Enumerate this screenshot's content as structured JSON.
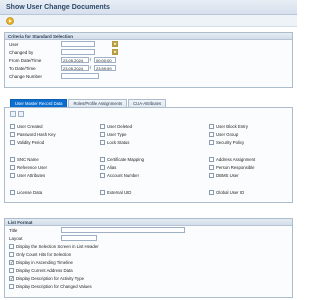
{
  "page": {
    "title": "Show User Change Documents"
  },
  "toolbar": {
    "execute_icon": "execute-icon"
  },
  "criteria": {
    "header": "Criteria for Standard Selection",
    "user_label": "User",
    "changed_by_label": "Changed by",
    "from_label": "From Date/Time",
    "to_label": "To Date/Time",
    "change_number_label": "Change Number",
    "user_value": "",
    "changed_by_value": "",
    "from_date": "23.05.2024",
    "from_time": "00:00:00",
    "to_date": "23.05.2024",
    "to_time": "23:59:59",
    "change_number_value": "",
    "date_time_sep": "/"
  },
  "tabs": [
    {
      "label": "User Master Record Data",
      "active": true
    },
    {
      "label": "Roles/Profile Assignments",
      "active": false
    },
    {
      "label": "CUA-Attributes",
      "active": false
    }
  ],
  "tab_fields": {
    "col1": [
      "User Created",
      "Password Hash Key",
      "Validity Period",
      "SNC Name",
      "Reference User",
      "User Attributes",
      "License Data"
    ],
    "col2": [
      "User Deleted",
      "User Type",
      "Lock Status",
      "Certificate Mapping",
      "Alias",
      "Account Number",
      "External UID"
    ],
    "col3": [
      "User Block Entry",
      "User Group",
      "Security Policy",
      "Address Assignment",
      "Person Responsible",
      "DBMS User",
      "Global User ID"
    ]
  },
  "list_format": {
    "header": "List Format",
    "title_label": "Title",
    "layout_label": "Layout",
    "title_value": "",
    "layout_value": "",
    "options": [
      {
        "label": "Display the Selection Screen in List Header",
        "checked": false
      },
      {
        "label": "Only Count Hits for Selection",
        "checked": false
      },
      {
        "label": "Display in Ascending Timeline",
        "checked": true
      },
      {
        "label": "Display Current Address Data",
        "checked": false
      },
      {
        "label": "Display Description for Activity Type",
        "checked": true
      },
      {
        "label": "Display Description for Changed Values",
        "checked": false
      }
    ]
  }
}
